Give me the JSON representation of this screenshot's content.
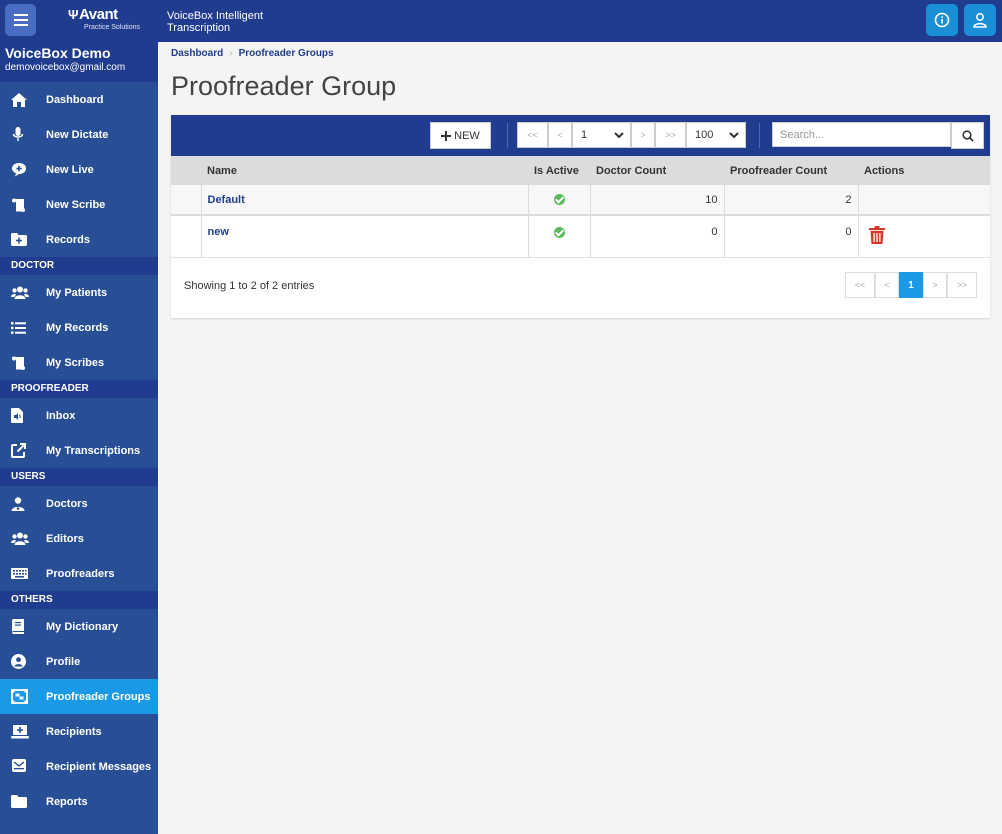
{
  "header": {
    "brand_name": "Avant",
    "brand_sub": "Practice Solutions",
    "app_title_line1": "VoiceBox Intelligent",
    "app_title_line2": "Transcription"
  },
  "sidebar": {
    "user_name": "VoiceBox Demo",
    "user_email": "demovoicebox@gmail.com",
    "items": [
      {
        "label": "Dashboard",
        "icon": "home-icon"
      },
      {
        "label": "New Dictate",
        "icon": "microphone-icon"
      },
      {
        "label": "New Live",
        "icon": "chat-plus-icon"
      },
      {
        "label": "New Scribe",
        "icon": "scroll-icon"
      },
      {
        "label": "Records",
        "icon": "folder-plus-icon"
      }
    ],
    "doctor_section": "DOCTOR",
    "doctor_items": [
      {
        "label": "My Patients",
        "icon": "users-icon"
      },
      {
        "label": "My Records",
        "icon": "list-icon"
      },
      {
        "label": "My Scribes",
        "icon": "scroll-icon"
      }
    ],
    "proofreader_section": "PROOFREADER",
    "proofreader_items": [
      {
        "label": "Inbox",
        "icon": "audio-file-icon"
      },
      {
        "label": "My Transcriptions",
        "icon": "external-link-icon"
      }
    ],
    "users_section": "USERS",
    "users_items": [
      {
        "label": "Doctors",
        "icon": "doctor-icon"
      },
      {
        "label": "Editors",
        "icon": "users-icon"
      },
      {
        "label": "Proofreaders",
        "icon": "keyboard-icon"
      }
    ],
    "others_section": "OTHERS",
    "others_items": [
      {
        "label": "My Dictionary",
        "icon": "book-icon"
      },
      {
        "label": "Profile",
        "icon": "user-circle-icon"
      },
      {
        "label": "Proofreader Groups",
        "icon": "group-icon"
      },
      {
        "label": "Recipients",
        "icon": "laptop-plus-icon"
      },
      {
        "label": "Recipient Messages",
        "icon": "message-icon"
      },
      {
        "label": "Reports",
        "icon": "folder-icon"
      }
    ],
    "active_item": "Proofreader Groups"
  },
  "breadcrumb": {
    "home": "Dashboard",
    "current": "Proofreader Groups"
  },
  "page_title": "Proofreader Group",
  "toolbar": {
    "new_label": "NEW",
    "first": "<<",
    "prev": "<",
    "page_value": "1",
    "next": ">",
    "last": ">>",
    "page_size": "100",
    "search_placeholder": "Search..."
  },
  "table": {
    "columns": [
      "Name",
      "Is Active",
      "Doctor Count",
      "Proofreader Count",
      "Actions"
    ],
    "rows": [
      {
        "name": "Default",
        "is_active": true,
        "doctor_count": "10",
        "proofreader_count": "2"
      },
      {
        "name": "new",
        "is_active": true,
        "doctor_count": "0",
        "proofreader_count": "0"
      }
    ]
  },
  "footer": {
    "info": "Showing 1 to 2 of 2 entries",
    "first": "<<",
    "prev": "<",
    "page": "1",
    "next": ">",
    "last": ">>"
  },
  "colors": {
    "header": "#1f3c8f",
    "sidebar": "#284f96",
    "active": "#1a9ae6",
    "delete": "#d33a2c",
    "check": "#5bb85c"
  }
}
